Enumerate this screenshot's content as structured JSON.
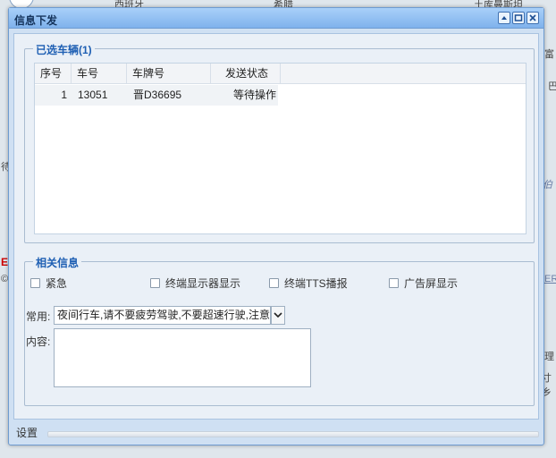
{
  "background": {
    "map_labels": [
      "西班牙",
      "希腊",
      "土库曼斯坦",
      "富",
      "巴",
      "伯",
      "待",
      "理",
      "寸乡"
    ],
    "red_marker": "E",
    "link_text": "ER",
    "copyright": "©"
  },
  "window": {
    "title": "信息下发",
    "buttons": {
      "minimize_icon": "minimize-icon",
      "maximize_icon": "maximize-icon",
      "close_icon": "close-icon"
    }
  },
  "vehicles": {
    "legend": "已选车辆(1)",
    "columns": [
      "序号",
      "车号",
      "车牌号",
      "发送状态"
    ],
    "rows": [
      {
        "index": "1",
        "vehicle_no": "13051",
        "plate": "晋D36695",
        "status": "等待操作"
      }
    ]
  },
  "info": {
    "legend": "相关信息",
    "options": [
      {
        "label": "紧急",
        "checked": false
      },
      {
        "label": "终端显示器显示",
        "checked": false
      },
      {
        "label": "终端TTS播报",
        "checked": false
      },
      {
        "label": "广告屏显示",
        "checked": false
      }
    ],
    "common_label": "常用:",
    "common_value": "夜间行车,请不要疲劳驾驶,不要超速行驶,注意",
    "content_label": "内容:",
    "content_value": ""
  },
  "footer": {
    "settings_label": "设置"
  },
  "colors": {
    "title_bg": "#7fb2ec",
    "legend_text": "#1e5fb3",
    "window_border": "#6e9bd0"
  }
}
